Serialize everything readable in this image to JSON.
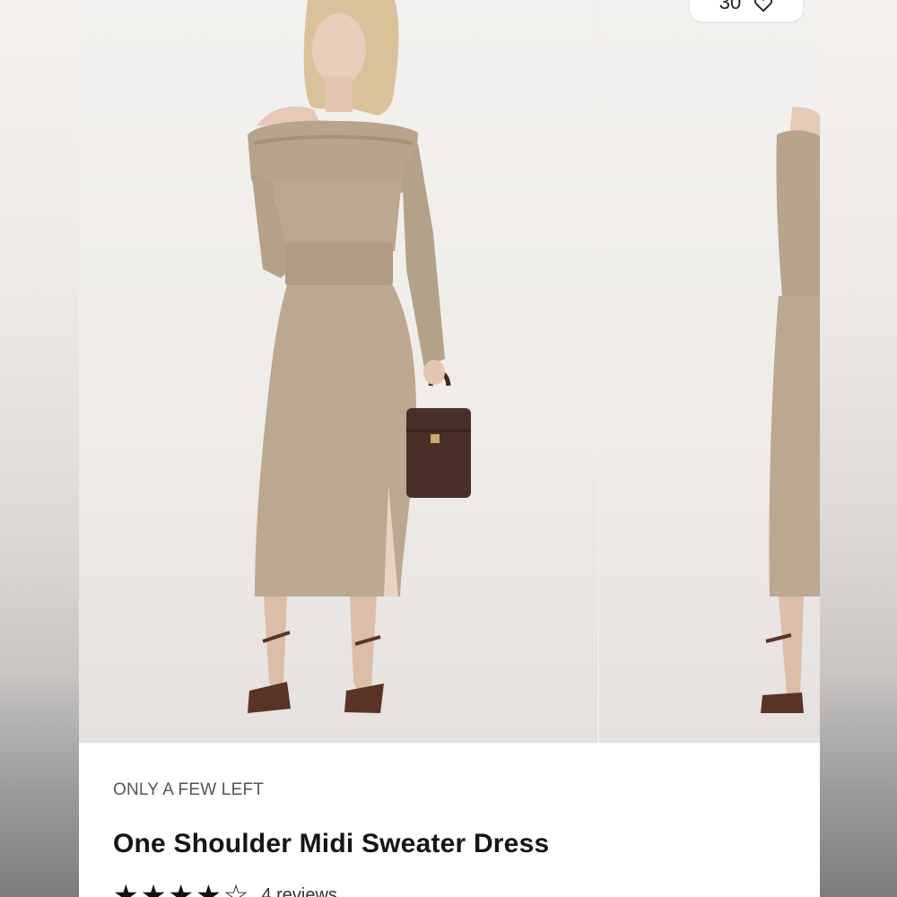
{
  "favorites": {
    "count": "30",
    "icon": "heart-outline-icon"
  },
  "product": {
    "stock_status": "ONLY A FEW LEFT",
    "title": "One Shoulder Midi Sweater Dress",
    "rating": {
      "filled_stars": 4,
      "total_stars": 5,
      "reviews_label": "4 reviews"
    }
  },
  "gallery": {
    "images": [
      {
        "name": "product-photo-front"
      },
      {
        "name": "product-photo-side"
      }
    ]
  },
  "colors": {
    "background": "#ffffff",
    "text_primary": "#151515",
    "text_secondary": "#555555",
    "dress": "#b9a48d",
    "bag": "#4a2f28"
  }
}
